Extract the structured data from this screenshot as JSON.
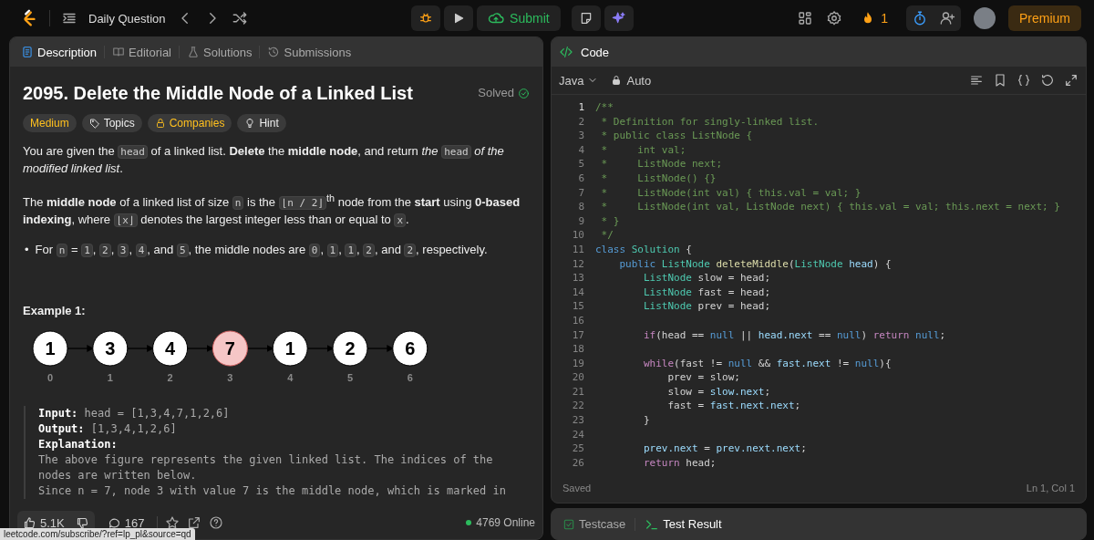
{
  "topbar": {
    "nav_title": "Daily Question",
    "submit": "Submit",
    "streak": "1",
    "premium": "Premium"
  },
  "description_panel": {
    "tabs": [
      {
        "label": "Description",
        "selected": true
      },
      {
        "label": "Editorial",
        "selected": false
      },
      {
        "label": "Solutions",
        "selected": false
      },
      {
        "label": "Submissions",
        "selected": false
      }
    ],
    "title": "2095. Delete the Middle Node of a Linked List",
    "status": "Solved",
    "tags": [
      {
        "label": "Medium",
        "kind": "difficulty"
      },
      {
        "label": "Topics",
        "kind": "topics"
      },
      {
        "label": "Companies",
        "kind": "companies"
      },
      {
        "label": "Hint",
        "kind": "hint"
      }
    ],
    "paragraphs": [
      [
        {
          "kind": "text",
          "text": "You are given the "
        },
        {
          "kind": "code",
          "text": "head"
        },
        {
          "kind": "text",
          "text": " of a linked list. **Delete** the **middle node**, and return *the* "
        },
        {
          "kind": "code",
          "text": "head"
        },
        {
          "kind": "text",
          "text": " *of the modified linked list*."
        }
      ],
      [
        {
          "kind": "text",
          "text": "The **middle node** of a linked list of size "
        },
        {
          "kind": "code",
          "text": "n"
        },
        {
          "kind": "text",
          "text": " is the "
        },
        {
          "kind": "code",
          "text": "⌊n / 2⌋"
        },
        {
          "kind": "text",
          "text": "$^{th}$ node from the **start** using **0-based indexing**, where "
        },
        {
          "kind": "code",
          "text": "⌊x⌋"
        },
        {
          "kind": "text",
          "text": " denotes the largest integer less than or equal to "
        },
        {
          "kind": "code",
          "text": "x"
        },
        {
          "kind": "text",
          "text": "."
        }
      ]
    ],
    "bullets": [
      {
        "marker": "•",
        "segments": [
          {
            "kind": "text",
            "text": "For "
          },
          {
            "kind": "code",
            "text": "n"
          },
          {
            "kind": "text",
            "text": " = "
          },
          {
            "kind": "code",
            "text": "1"
          },
          {
            "kind": "text",
            "text": ", "
          },
          {
            "kind": "code",
            "text": "2"
          },
          {
            "kind": "text",
            "text": ", "
          },
          {
            "kind": "code",
            "text": "3"
          },
          {
            "kind": "text",
            "text": ", "
          },
          {
            "kind": "code",
            "text": "4"
          },
          {
            "kind": "text",
            "text": ", and "
          },
          {
            "kind": "code",
            "text": "5"
          },
          {
            "kind": "text",
            "text": ", the middle nodes are "
          },
          {
            "kind": "code",
            "text": "0"
          },
          {
            "kind": "text",
            "text": ", "
          },
          {
            "kind": "code",
            "text": "1"
          },
          {
            "kind": "text",
            "text": ", "
          },
          {
            "kind": "code",
            "text": "1"
          },
          {
            "kind": "text",
            "text": ", "
          },
          {
            "kind": "code",
            "text": "2"
          },
          {
            "kind": "text",
            "text": ", and "
          },
          {
            "kind": "code",
            "text": "2"
          },
          {
            "kind": "text",
            "text": ", respectively."
          }
        ]
      }
    ],
    "example": {
      "heading": "Example 1:",
      "figure_nodes": [
        {
          "value": "1",
          "index": "0",
          "highlighted": false
        },
        {
          "value": "3",
          "index": "1",
          "highlighted": false
        },
        {
          "value": "4",
          "index": "2",
          "highlighted": false
        },
        {
          "value": "7",
          "index": "3",
          "highlighted": true
        },
        {
          "value": "1",
          "index": "4",
          "highlighted": false
        },
        {
          "value": "2",
          "index": "5",
          "highlighted": false
        },
        {
          "value": "6",
          "index": "6",
          "highlighted": false
        }
      ],
      "io": [
        {
          "label": "Input:",
          "value": "head = [1,3,4,7,1,2,6]"
        },
        {
          "label": "Output:",
          "value": "[1,3,4,1,2,6]"
        }
      ],
      "explanation_label": "Explanation:",
      "explanation_lines": [
        "The above figure represents the given linked list. The indices of the",
        "nodes are written below.",
        "Since n = 7, node 3 with value 7 is the middle node, which is marked in"
      ]
    },
    "footer": {
      "likes": "5.1K",
      "comments": "167",
      "online": "4769 Online"
    }
  },
  "status_url": "leetcode.com/subscribe/?ref=lp_pl&source=qd",
  "code_panel": {
    "title": "Code",
    "language": "Java",
    "mode": "Auto",
    "lines": [
      {
        "number": "1",
        "tokens": [
          {
            "kind": "comment",
            "text": "/**"
          }
        ]
      },
      {
        "number": "2",
        "tokens": [
          {
            "kind": "comment",
            "text": " * Definition for singly-linked list."
          }
        ]
      },
      {
        "number": "3",
        "tokens": [
          {
            "kind": "comment",
            "text": " * public class ListNode {"
          }
        ]
      },
      {
        "number": "4",
        "tokens": [
          {
            "kind": "comment",
            "text": " *     int val;"
          }
        ]
      },
      {
        "number": "5",
        "tokens": [
          {
            "kind": "comment",
            "text": " *     ListNode next;"
          }
        ]
      },
      {
        "number": "6",
        "tokens": [
          {
            "kind": "comment",
            "text": " *     ListNode() {}"
          }
        ]
      },
      {
        "number": "7",
        "tokens": [
          {
            "kind": "comment",
            "text": " *     ListNode(int val) { this.val = val; }"
          }
        ]
      },
      {
        "number": "8",
        "tokens": [
          {
            "kind": "comment",
            "text": " *     ListNode(int val, ListNode next) { this.val = val; this.next = next; }"
          }
        ]
      },
      {
        "number": "9",
        "tokens": [
          {
            "kind": "comment",
            "text": " * }"
          }
        ]
      },
      {
        "number": "10",
        "tokens": [
          {
            "kind": "comment",
            "text": " */"
          }
        ]
      },
      {
        "number": "11",
        "tokens": [
          {
            "kind": "keyword",
            "text": "class "
          },
          {
            "kind": "type",
            "text": "Solution"
          },
          {
            "kind": "plain",
            "text": " {"
          }
        ]
      },
      {
        "number": "12",
        "tokens": [
          {
            "kind": "keyword",
            "text": "    public "
          },
          {
            "kind": "type",
            "text": "ListNode "
          },
          {
            "kind": "function",
            "text": "deleteMiddle"
          },
          {
            "kind": "plain",
            "text": "("
          },
          {
            "kind": "type",
            "text": "ListNode "
          },
          {
            "kind": "variable",
            "text": "head"
          },
          {
            "kind": "plain",
            "text": ") {"
          }
        ]
      },
      {
        "number": "13",
        "tokens": [
          {
            "kind": "type",
            "text": "        ListNode"
          },
          {
            "kind": "plain",
            "text": " slow = head;"
          }
        ]
      },
      {
        "number": "14",
        "tokens": [
          {
            "kind": "type",
            "text": "        ListNode"
          },
          {
            "kind": "plain",
            "text": " fast = head;"
          }
        ]
      },
      {
        "number": "15",
        "tokens": [
          {
            "kind": "type",
            "text": "        ListNode"
          },
          {
            "kind": "plain",
            "text": " prev = head;"
          }
        ]
      },
      {
        "number": "16"
      },
      {
        "number": "17",
        "tokens": [
          {
            "kind": "control",
            "text": "        if"
          },
          {
            "kind": "plain",
            "text": "(head == "
          },
          {
            "kind": "keyword",
            "text": "null"
          },
          {
            "kind": "plain",
            "text": " || "
          },
          {
            "kind": "variable",
            "text": "head.next"
          },
          {
            "kind": "plain",
            "text": " == "
          },
          {
            "kind": "keyword",
            "text": "null"
          },
          {
            "kind": "plain",
            "text": ") "
          },
          {
            "kind": "control",
            "text": "return "
          },
          {
            "kind": "keyword",
            "text": "null"
          },
          {
            "kind": "plain",
            "text": ";"
          }
        ]
      },
      {
        "number": "18"
      },
      {
        "number": "19",
        "tokens": [
          {
            "kind": "control",
            "text": "        while"
          },
          {
            "kind": "plain",
            "text": "(fast != "
          },
          {
            "kind": "keyword",
            "text": "null"
          },
          {
            "kind": "plain",
            "text": " && "
          },
          {
            "kind": "variable",
            "text": "fast.next"
          },
          {
            "kind": "plain",
            "text": " != "
          },
          {
            "kind": "keyword",
            "text": "null"
          },
          {
            "kind": "plain",
            "text": "){"
          }
        ]
      },
      {
        "number": "20",
        "tokens": [
          {
            "kind": "plain",
            "text": "            prev = slow;"
          }
        ]
      },
      {
        "number": "21",
        "tokens": [
          {
            "kind": "plain",
            "text": "            slow = "
          },
          {
            "kind": "variable",
            "text": "slow.next"
          },
          {
            "kind": "plain",
            "text": ";"
          }
        ]
      },
      {
        "number": "22",
        "tokens": [
          {
            "kind": "plain",
            "text": "            fast = "
          },
          {
            "kind": "variable",
            "text": "fast.next.next"
          },
          {
            "kind": "plain",
            "text": ";"
          }
        ]
      },
      {
        "number": "23",
        "tokens": [
          {
            "kind": "plain",
            "text": "        }"
          }
        ]
      },
      {
        "number": "24"
      },
      {
        "number": "25",
        "tokens": [
          {
            "kind": "variable",
            "text": "        prev.next"
          },
          {
            "kind": "plain",
            "text": " = "
          },
          {
            "kind": "variable",
            "text": "prev.next.next"
          },
          {
            "kind": "plain",
            "text": ";"
          }
        ]
      },
      {
        "number": "26",
        "tokens": [
          {
            "kind": "control",
            "text": "        return"
          },
          {
            "kind": "plain",
            "text": " head;"
          }
        ]
      }
    ],
    "save_status": "Saved",
    "cursor": "Ln 1, Col 1"
  },
  "test_panel": {
    "tabs": [
      {
        "label": "Testcase",
        "kind": "testcase",
        "selected": false
      },
      {
        "label": "Test Result",
        "kind": "result",
        "selected": true
      }
    ]
  }
}
